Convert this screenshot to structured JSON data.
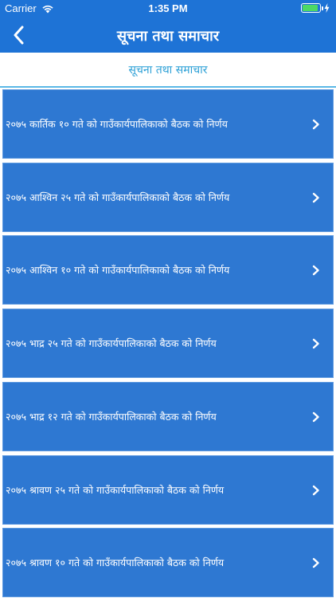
{
  "status": {
    "carrier": "Carrier",
    "time": "1:35 PM",
    "battery_color": "#4cd964",
    "icons": [
      "wifi-icon",
      "battery-icon",
      "charging-bolt-icon"
    ]
  },
  "navbar": {
    "title": "सूचना तथा समाचार",
    "back_icon": "chevron-left-icon",
    "background_color": "#1e73d6"
  },
  "subheader": {
    "title": "सूचना तथा समाचार",
    "accent_color": "#2a9fd6"
  },
  "list": {
    "item_color": "#2e78d2",
    "chevron_icon": "chevron-right-icon",
    "items": [
      {
        "label": "२०७५ कार्तिक १० गते को गाउँकार्यपालिकाको बैठक को निर्णय"
      },
      {
        "label": "२०७५ आश्विन २५ गते को गाउँकार्यपालिकाको बैठक को निर्णय"
      },
      {
        "label": "२०७५ आश्विन १० गते को गाउँकार्यपालिकाको बैठक को निर्णय"
      },
      {
        "label": "२०७५ भाद्र २५ गते को गाउँकार्यपालिकाको बैठक को निर्णय"
      },
      {
        "label": "२०७५ भाद्र १२ गते को गाउँकार्यपालिकाको बैठक को निर्णय"
      },
      {
        "label": "२०७५ श्रावण २५ गते को गाउँकार्यपालिकाको बैठक को निर्णय"
      },
      {
        "label": "२०७५ श्रावण १० गते को गाउँकार्यपालिकाको बैठक को निर्णय"
      }
    ]
  }
}
